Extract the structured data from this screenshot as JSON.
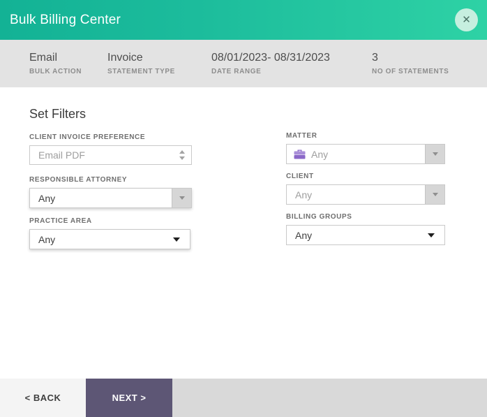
{
  "window": {
    "title": "Bulk Billing Center",
    "close_glyph": "✕"
  },
  "summary": {
    "items": [
      {
        "value": "Email",
        "label": "BULK ACTION"
      },
      {
        "value": "Invoice",
        "label": "STATEMENT TYPE"
      },
      {
        "value": "08/01/2023- 08/31/2023",
        "label": "DATE RANGE"
      },
      {
        "value": "3",
        "label": "NO OF STATEMENTS"
      }
    ]
  },
  "filters": {
    "heading": "Set Filters",
    "client_invoice_preference": {
      "label": "CLIENT INVOICE PREFERENCE",
      "value": "Email PDF"
    },
    "responsible_attorney": {
      "label": "RESPONSIBLE ATTORNEY",
      "value": "Any"
    },
    "practice_area": {
      "label": "PRACTICE AREA",
      "value": "Any"
    },
    "matter": {
      "label": "MATTER",
      "value": "Any",
      "icon": "briefcase-icon"
    },
    "client": {
      "label": "CLIENT",
      "value": "Any"
    },
    "billing_groups": {
      "label": "BILLING GROUPS",
      "value": "Any"
    }
  },
  "footer": {
    "back_label": "< BACK",
    "next_label": "NEXT >"
  },
  "colors": {
    "header_gradient_start": "#13b295",
    "header_gradient_end": "#2ed2a5",
    "close_circle": "#c6efdf",
    "summary_bg": "#e3e3e3",
    "footer_bg": "#d9d9d9",
    "back_bg": "#f4f4f4",
    "next_purple": "#5d5675",
    "matter_icon_purple": "#8b68c8",
    "label_gray": "#6e6e6e",
    "placeholder_gray": "#9e9e9e"
  }
}
